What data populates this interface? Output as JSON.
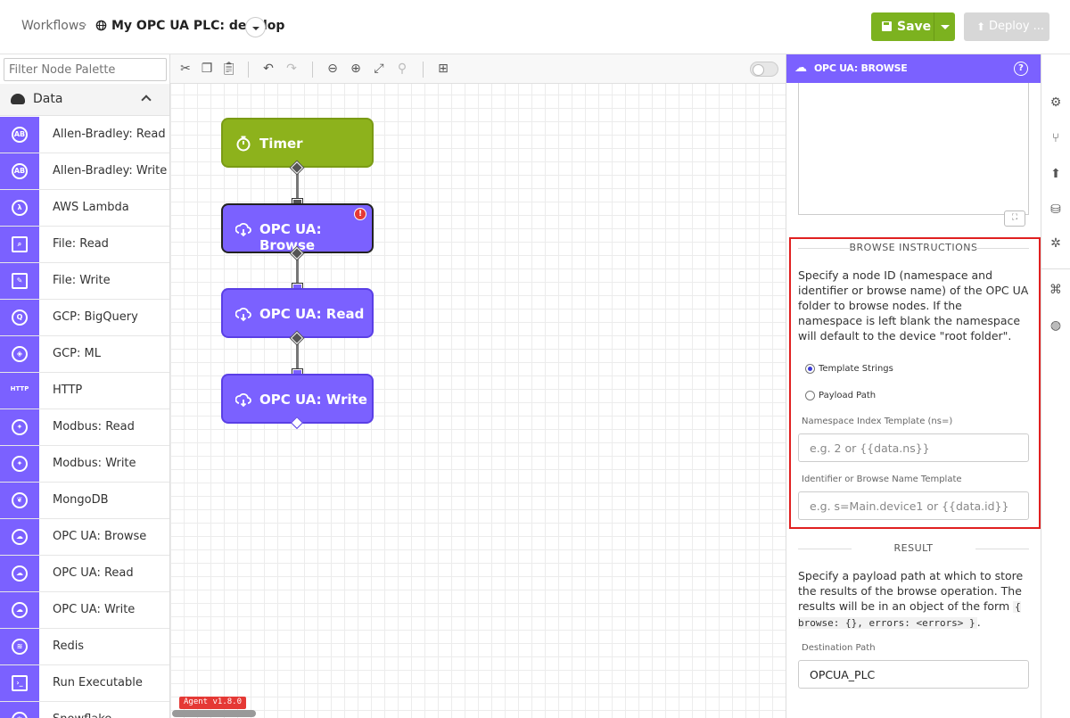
{
  "header": {
    "crumb_root": "Workflows",
    "crumb_sep": "›",
    "title": "My OPC UA PLC: develop",
    "save_label": "Save",
    "deploy_label": "Deploy ..."
  },
  "palette": {
    "filter_placeholder": "Filter Node Palette",
    "category": "Data",
    "items": [
      {
        "label": "Allen-Bradley: Read",
        "icon": "allen-bradley-icon",
        "glyph": "AB"
      },
      {
        "label": "Allen-Bradley: Write",
        "icon": "allen-bradley-icon",
        "glyph": "AB"
      },
      {
        "label": "AWS Lambda",
        "icon": "aws-lambda-icon",
        "glyph": "λ"
      },
      {
        "label": "File: Read",
        "icon": "file-icon",
        "glyph": "⌕"
      },
      {
        "label": "File: Write",
        "icon": "file-icon",
        "glyph": "✎"
      },
      {
        "label": "GCP: BigQuery",
        "icon": "gcp-bigquery-icon",
        "glyph": "Q"
      },
      {
        "label": "GCP: ML",
        "icon": "gcp-ml-icon",
        "glyph": "◈"
      },
      {
        "label": "HTTP",
        "icon": "http-icon",
        "glyph": "HTTP"
      },
      {
        "label": "Modbus: Read",
        "icon": "modbus-icon",
        "glyph": "✦"
      },
      {
        "label": "Modbus: Write",
        "icon": "modbus-icon",
        "glyph": "✦"
      },
      {
        "label": "MongoDB",
        "icon": "mongodb-icon",
        "glyph": "❦"
      },
      {
        "label": "OPC UA: Browse",
        "icon": "opc-ua-icon",
        "glyph": "☁"
      },
      {
        "label": "OPC UA: Read",
        "icon": "opc-ua-icon",
        "glyph": "☁"
      },
      {
        "label": "OPC UA: Write",
        "icon": "opc-ua-icon",
        "glyph": "☁"
      },
      {
        "label": "Redis",
        "icon": "redis-icon",
        "glyph": "≋"
      },
      {
        "label": "Run Executable",
        "icon": "terminal-icon",
        "glyph": "›_"
      },
      {
        "label": "Snowflake",
        "icon": "snowflake-icon",
        "glyph": "❄"
      }
    ]
  },
  "canvas": {
    "nodes": [
      {
        "label": "Timer",
        "icon": "stopwatch-icon"
      },
      {
        "label": "OPC UA: Browse",
        "icon": "opc-ua-icon",
        "error_badge": "!"
      },
      {
        "label": "OPC UA: Read",
        "icon": "opc-ua-icon"
      },
      {
        "label": "OPC UA: Write",
        "icon": "opc-ua-icon"
      }
    ],
    "agent_badge": "Agent v1.8.0"
  },
  "panel": {
    "title": "OPC UA: BROWSE",
    "help_glyph": "?",
    "browse_section": {
      "title": "BROWSE INSTRUCTIONS",
      "description": "Specify a node ID (namespace and identifier or browse name) of the OPC UA folder to browse nodes. If the namespace is left blank the namespace will default to the device \"root folder\".",
      "radio_template": "Template Strings",
      "radio_payload": "Payload Path",
      "selected": "Template Strings",
      "ns_label": "Namespace Index Template (ns=)",
      "ns_placeholder": "e.g. 2 or {{data.ns}}",
      "id_label": "Identifier or Browse Name Template",
      "id_placeholder": "e.g. s=Main.device1 or {{data.id}}"
    },
    "result_section": {
      "title": "RESULT",
      "description_1": "Specify a payload path at which to store the results of the browse operation. The results will be in an object of the form ",
      "code": "{ browse: {}, errors: <errors> }",
      "description_2": ".",
      "dest_label": "Destination Path",
      "dest_value": "OPCUA_PLC"
    }
  },
  "colors": {
    "accent_purple": "#7b61ff",
    "timer_green": "#8db21c",
    "save_green": "#7cb21f",
    "highlight_red": "#e02020"
  }
}
